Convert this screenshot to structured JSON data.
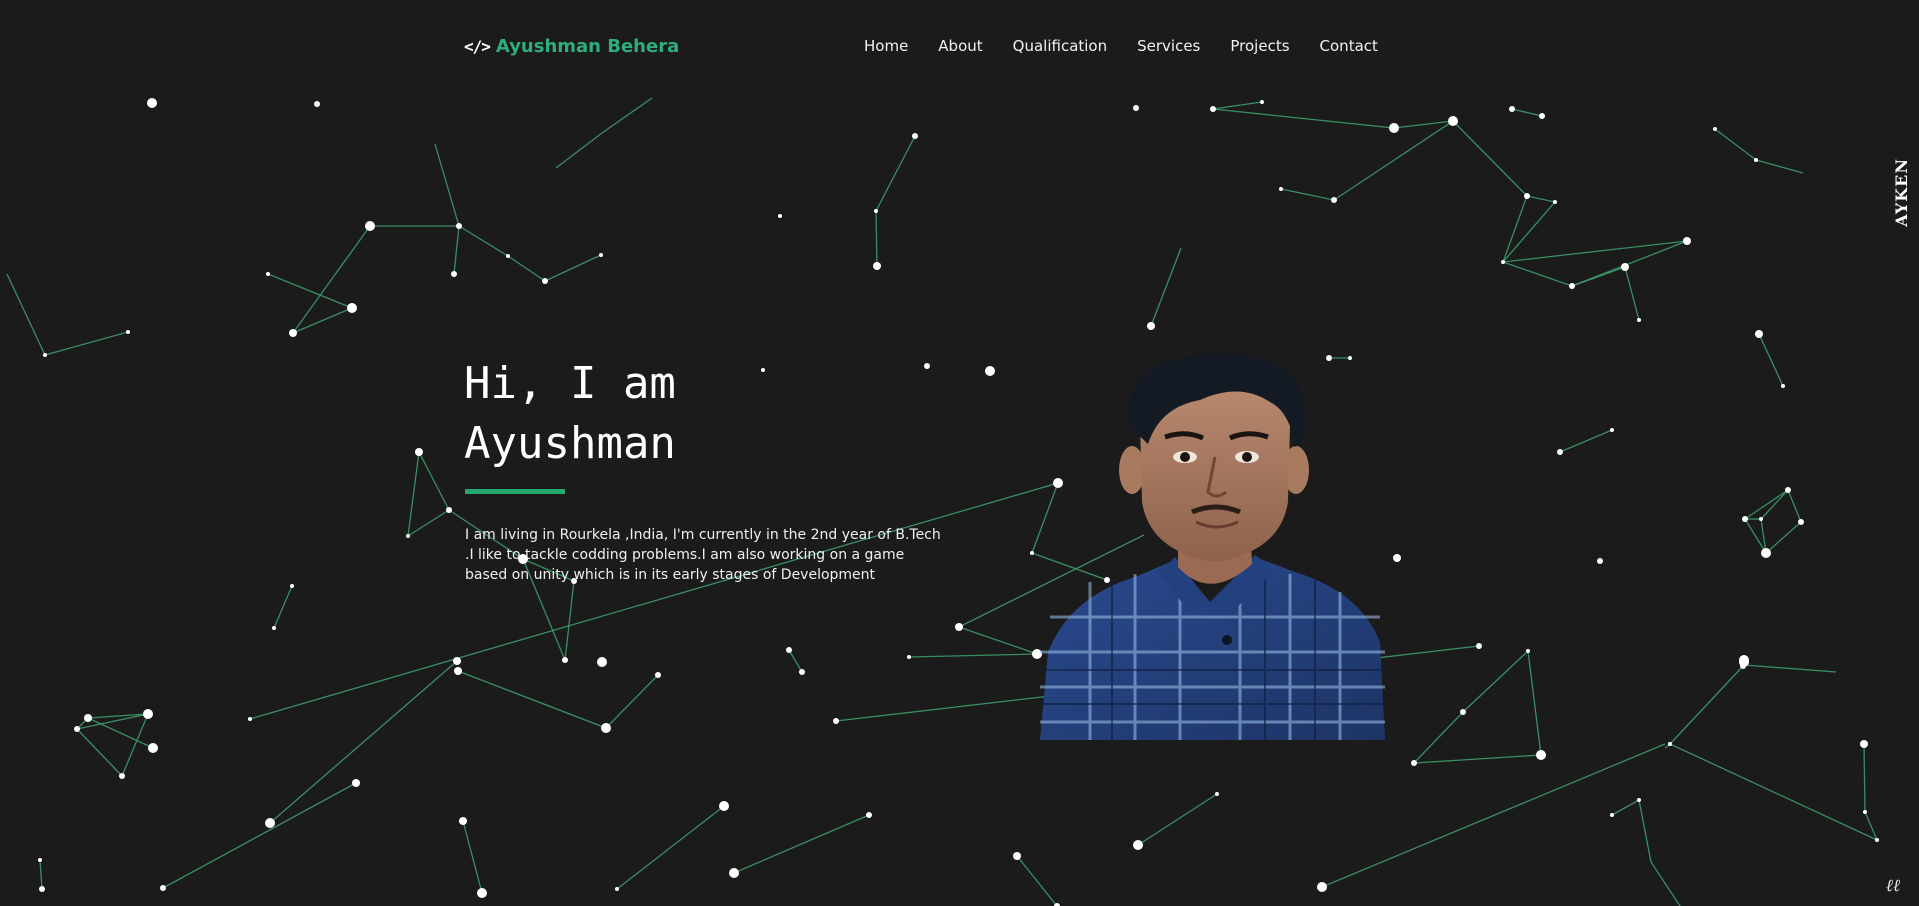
{
  "header": {
    "logo_icon": "</>",
    "logo_text": "Ayushman Behera",
    "nav": [
      "Home",
      "About",
      "Qualification",
      "Services",
      "Projects",
      "Contact"
    ]
  },
  "hero": {
    "title_line1": "Hi, I am",
    "title_line2": "Ayushman",
    "description": "I am living in Rourkela ,India, I'm currently in the 2nd year of B.Tech .I like to tackle codding problems.I am also working on a game based on unity which is in its early stages of Development"
  },
  "side_brand": "AYKEN",
  "corner_badge": "ℓℓ",
  "colors": {
    "background": "#1b1b1b",
    "accent": "#2fae7b",
    "particle_line": "#3fa36f",
    "particle_dot": "#ffffff"
  },
  "icons": {
    "logo": "code-brackets-icon",
    "portrait": "profile-photo"
  }
}
